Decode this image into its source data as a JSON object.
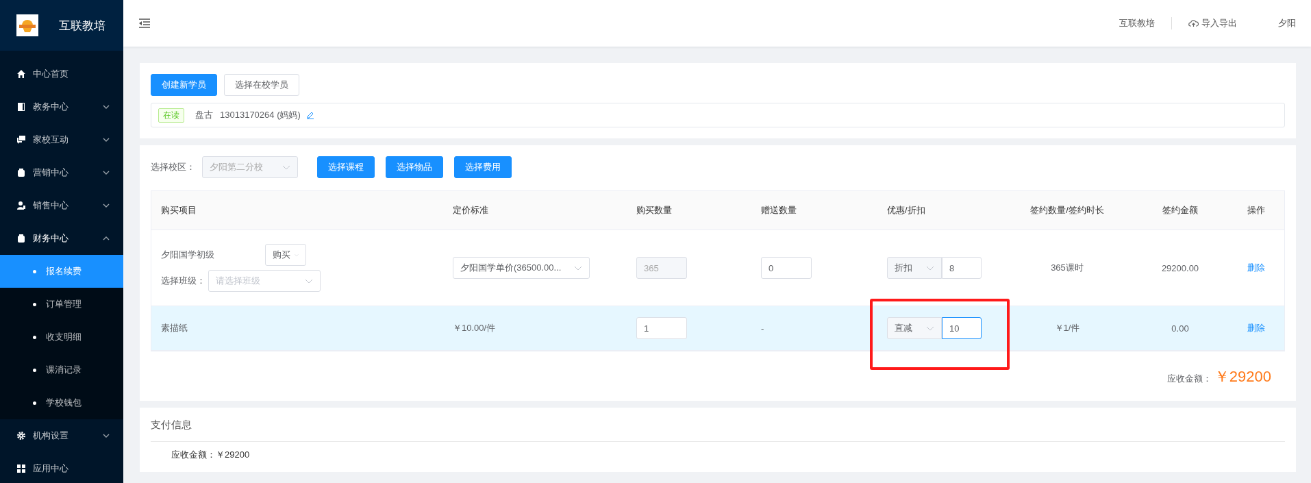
{
  "sidebar": {
    "brand": "互联教培",
    "items": [
      {
        "kind": "link",
        "label": "中心首页"
      },
      {
        "kind": "group",
        "label": "教务中心",
        "expanded": false
      },
      {
        "kind": "group",
        "label": "家校互动",
        "expanded": false
      },
      {
        "kind": "group",
        "label": "营销中心",
        "expanded": false
      },
      {
        "kind": "group",
        "label": "销售中心",
        "expanded": false
      },
      {
        "kind": "group",
        "label": "财务中心",
        "expanded": true,
        "children": [
          {
            "label": "报名续费",
            "selected": true
          },
          {
            "label": "订单管理",
            "selected": false
          },
          {
            "label": "收支明细",
            "selected": false
          },
          {
            "label": "课消记录",
            "selected": false
          },
          {
            "label": "学校钱包",
            "selected": false
          }
        ]
      },
      {
        "kind": "group",
        "label": "机构设置",
        "expanded": false
      },
      {
        "kind": "link",
        "label": "应用中心"
      }
    ]
  },
  "header": {
    "org": "互联教培",
    "import_export": "导入导出",
    "user": "夕阳"
  },
  "student": {
    "buttons": [
      {
        "label": "创建新学员",
        "primary": true
      },
      {
        "label": "选择在校学员",
        "primary": false
      }
    ],
    "status_tag": "在读",
    "name": "盘古",
    "phone": "13013170264 (妈妈)"
  },
  "order": {
    "campus_label": "选择校区：",
    "campus_value": "夕阳第二分校",
    "buttons": [
      "选择课程",
      "选择物品",
      "选择费用"
    ],
    "columns": [
      "购买项目",
      "定价标准",
      "购买数量",
      "赠送数量",
      "优惠/折扣",
      "签约数量/签约时长",
      "签约金额",
      "操作"
    ],
    "rows": [
      {
        "kind": "course",
        "item": "夕阳国学初级",
        "type": "购买",
        "class_label": "选择班级：",
        "class_placeholder": "请选择班级",
        "pricing": "夕阳国学单价(36500.00...",
        "quantity": "365",
        "quantity_disabled": true,
        "gift": "0",
        "discount_type": "折扣",
        "discount_value": "8",
        "discount_focused": false,
        "contract": "365课时",
        "amount": "29200.00",
        "action": "删除",
        "highlighted": false
      },
      {
        "kind": "goods",
        "item": "素描纸",
        "pricing": "￥10.00/件",
        "quantity": "1",
        "quantity_disabled": false,
        "gift": "-",
        "discount_type": "直减",
        "discount_value": "10",
        "discount_focused": true,
        "contract": "￥1/件",
        "amount": "0.00",
        "action": "删除",
        "highlighted": true
      }
    ],
    "total_label": "应收金额：",
    "total": "￥29200"
  },
  "payment": {
    "title": "支付信息",
    "due_label": "应收金额：",
    "due_value": "￥29200"
  }
}
